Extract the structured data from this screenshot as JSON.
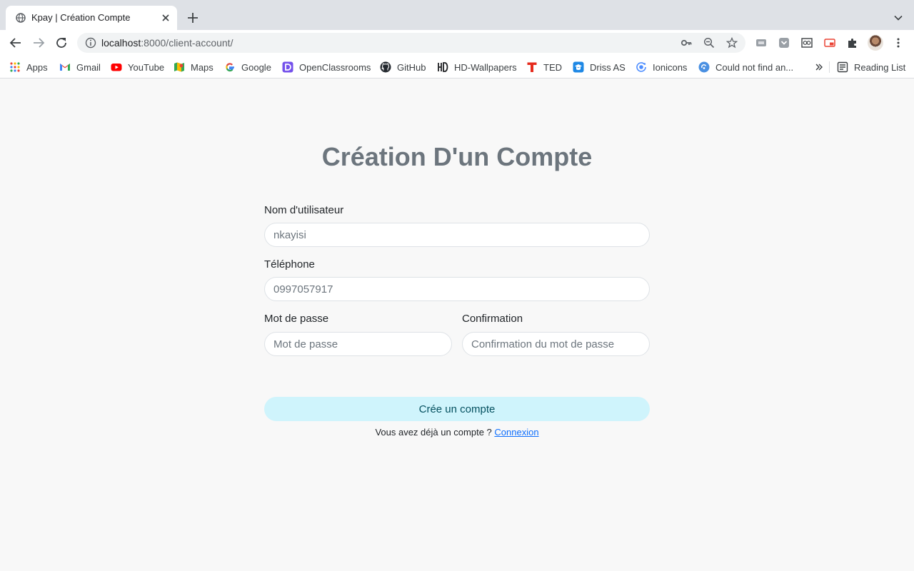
{
  "browser": {
    "tab": {
      "title": "Kpay | Création Compte",
      "favicon": "globe-icon"
    },
    "address_bar": {
      "host": "localhost",
      "rest": ":8000/client-account/"
    },
    "bookmarks": [
      {
        "label": "Apps",
        "icon": "apps-grid-icon"
      },
      {
        "label": "Gmail",
        "icon": "gmail-icon"
      },
      {
        "label": "YouTube",
        "icon": "youtube-icon"
      },
      {
        "label": "Maps",
        "icon": "maps-icon"
      },
      {
        "label": "Google",
        "icon": "google-icon"
      },
      {
        "label": "OpenClassrooms",
        "icon": "openclassrooms-icon"
      },
      {
        "label": "GitHub",
        "icon": "github-icon"
      },
      {
        "label": "HD-Wallpapers",
        "icon": "hd-icon"
      },
      {
        "label": "TED",
        "icon": "ted-icon"
      },
      {
        "label": "Driss AS",
        "icon": "driss-icon"
      },
      {
        "label": "Ionicons",
        "icon": "ionicons-icon"
      },
      {
        "label": "Could not find an...",
        "icon": "web-icon"
      }
    ],
    "reading_list": "Reading List"
  },
  "form": {
    "title": "Création D'un Compte",
    "username": {
      "label": "Nom d'utilisateur",
      "value": "nkayisi"
    },
    "phone": {
      "label": "Téléphone",
      "value": "0997057917"
    },
    "password": {
      "label": "Mot de passe",
      "placeholder": "Mot de passe"
    },
    "confirm": {
      "label": "Confirmation",
      "placeholder": "Confirmation du mot de passe"
    },
    "submit_label": "Crée un compte",
    "login_prompt": "Vous avez déjà un compte ? ",
    "login_link": "Connexion"
  },
  "colors": {
    "title": "#6c757d",
    "button_bg": "#cff4fc",
    "button_text": "#055160",
    "link": "#0d6efd"
  }
}
